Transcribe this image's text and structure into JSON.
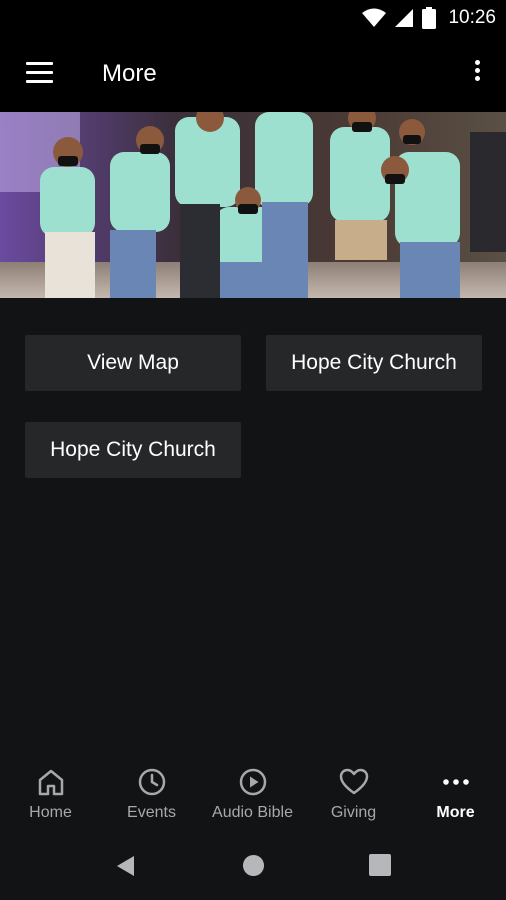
{
  "status": {
    "time": "10:26",
    "icons": [
      "wifi-icon",
      "signal-icon",
      "battery-icon"
    ]
  },
  "appbar": {
    "title": "More",
    "menu_icon": "hamburger-menu-icon",
    "overflow_icon": "overflow-menu-icon"
  },
  "hero": {
    "alt": "Group photo of church members wearing WELCOME shirts and masks"
  },
  "buttons": [
    {
      "label": "View Map"
    },
    {
      "label": "Hope City Church"
    },
    {
      "label": "Hope City Church"
    }
  ],
  "nav": {
    "items": [
      {
        "label": "Home",
        "icon": "home-icon"
      },
      {
        "label": "Events",
        "icon": "clock-icon"
      },
      {
        "label": "Audio Bible",
        "icon": "play-circle-icon"
      },
      {
        "label": "Giving",
        "icon": "heart-icon"
      },
      {
        "label": "More",
        "icon": "more-dots-icon",
        "active": true
      }
    ]
  },
  "colors": {
    "background": "#121315",
    "bar": "#000000",
    "tile": "#262729",
    "inactive": "#a6a8ab",
    "active": "#ffffff"
  }
}
